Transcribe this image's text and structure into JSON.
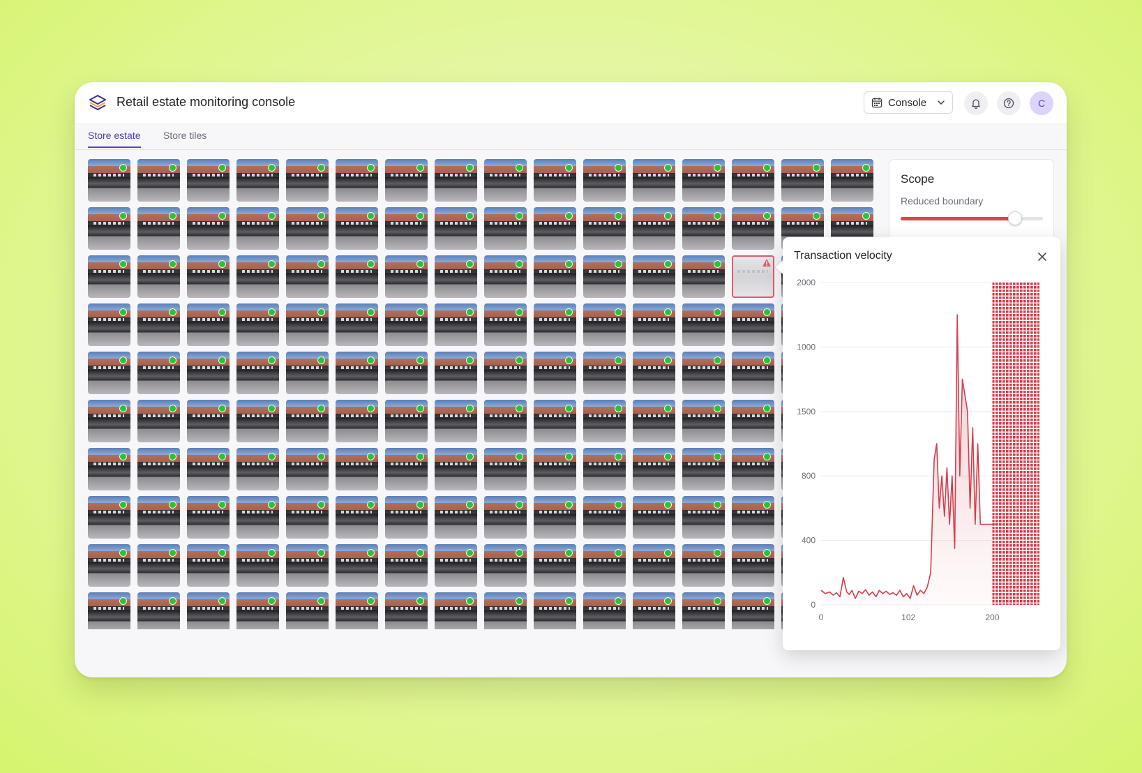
{
  "app": {
    "title": "Retail estate monitoring console",
    "icons": {
      "logo": "stacked-layers-logo",
      "calendar": "calendar-icon",
      "chevron": "chevron-down-icon",
      "bell": "bell-icon",
      "help": "help-circle-icon"
    },
    "console_label": "Console",
    "avatar_initial": "C",
    "accent": "#5b3fc4"
  },
  "tabs": [
    {
      "label": "Store estate",
      "active": true
    },
    {
      "label": "Store tiles",
      "active": false
    }
  ],
  "grid": {
    "columns": 16,
    "status_color_ok": "#2fbf3a",
    "alert_color": "#e05a6a",
    "alert_tile": {
      "row": 3,
      "col": 14
    }
  },
  "scope": {
    "title": "Scope",
    "slider_label": "Reduced boundary",
    "slider_value": 0.8,
    "slider_color": "#e2414e"
  },
  "popover": {
    "title": "Transaction velocity",
    "close_icon": "close-icon"
  },
  "chart_data": {
    "type": "line",
    "title": "Transaction velocity",
    "color": "#d43e4b",
    "x_ticks": [
      "0",
      "102",
      "200"
    ],
    "y_ticks": [
      "0",
      "400",
      "800",
      "1500",
      "1000",
      "2000"
    ],
    "x": [
      0,
      5,
      10,
      14,
      18,
      22,
      26,
      30,
      33,
      36,
      40,
      44,
      48,
      52,
      56,
      60,
      64,
      68,
      72,
      76,
      80,
      84,
      88,
      92,
      96,
      100,
      104,
      108,
      112,
      116,
      120,
      124,
      128,
      132,
      135,
      138,
      141,
      144,
      147,
      150,
      153,
      156,
      159,
      162,
      165,
      168,
      171,
      174,
      177,
      180,
      183,
      186,
      190,
      195,
      200,
      203,
      206
    ],
    "y": [
      90,
      70,
      80,
      60,
      75,
      50,
      170,
      80,
      65,
      90,
      40,
      85,
      70,
      95,
      60,
      80,
      50,
      90,
      70,
      85,
      65,
      75,
      60,
      90,
      50,
      70,
      40,
      120,
      60,
      90,
      70,
      110,
      200,
      900,
      1000,
      600,
      800,
      550,
      850,
      500,
      800,
      350,
      1800,
      800,
      1400,
      1300,
      1200,
      600,
      1100,
      500,
      1000,
      500,
      500,
      500,
      500,
      500,
      500
    ],
    "hatched_region_x": [
      200,
      255
    ],
    "xlim": [
      0,
      255
    ],
    "grid": true
  }
}
